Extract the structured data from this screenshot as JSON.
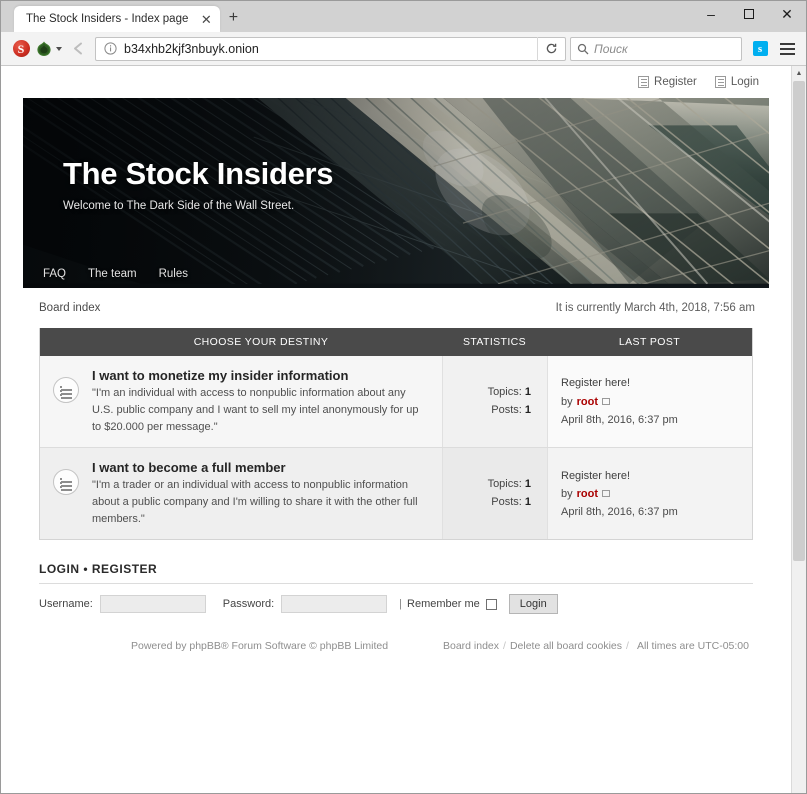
{
  "browser": {
    "tab_title": "The Stock Insiders - Index page",
    "tab_close": "✕",
    "new_tab": "+",
    "window_minimize": "–",
    "window_maximize": "☐",
    "window_close": "✕",
    "noscript_label": "S",
    "back_arrow": "←",
    "url": "b34xhb2kjf3nbuyk.onion",
    "reload": "⟳",
    "search_placeholder": "Поиск",
    "skype_label": "s"
  },
  "header": {
    "register_label": "Register",
    "login_label": "Login"
  },
  "banner": {
    "site_title": "The Stock Insiders",
    "tagline": "Welcome to The Dark Side of the Wall Street."
  },
  "nav": {
    "items": [
      {
        "label": "FAQ"
      },
      {
        "label": "The team"
      },
      {
        "label": "Rules"
      }
    ]
  },
  "crumb": {
    "board_index": "Board index",
    "current_time": "It is currently March 4th, 2018, 7:56 am"
  },
  "table": {
    "headers": {
      "destiny": "CHOOSE YOUR DESTINY",
      "statistics": "STATISTICS",
      "last_post": "LAST POST"
    },
    "rows": [
      {
        "title": "I want to monetize my insider information",
        "desc": "\"I'm an individual with access to nonpublic information about any U.S. public company and I want to sell my intel anonymously for up to $20.000 per message.\"",
        "topics_label": "Topics:",
        "topics_value": "1",
        "posts_label": "Posts:",
        "posts_value": "1",
        "last_post_title": "Register here!",
        "last_post_by": "by",
        "last_post_author": "root",
        "last_post_date": "April 8th, 2016, 6:37 pm"
      },
      {
        "title": "I want to become a full member",
        "desc": "\"I'm a trader or an individual with access to nonpublic information about a public company and I'm willing to share it with the other full members.\"",
        "topics_label": "Topics:",
        "topics_value": "1",
        "posts_label": "Posts:",
        "posts_value": "1",
        "last_post_title": "Register here!",
        "last_post_by": "by",
        "last_post_author": "root",
        "last_post_date": "April 8th, 2016, 6:37 pm"
      }
    ]
  },
  "login": {
    "heading": "LOGIN • REGISTER",
    "username_label": "Username:",
    "password_label": "Password:",
    "divider": "|",
    "remember_label": "Remember me",
    "submit_label": "Login",
    "username_value": "",
    "password_value": ""
  },
  "footer": {
    "powered_by": "Powered by phpBB® Forum Software © phpBB Limited",
    "board_index": "Board index",
    "sep1": "/",
    "delete_cookies": "Delete all board cookies",
    "sep2": "/",
    "timezone": "All times are UTC-05:00"
  },
  "colors": {
    "table_header_bg": "#4a4a4a",
    "author_red": "#aa0000",
    "skype_blue": "#00aff0"
  }
}
